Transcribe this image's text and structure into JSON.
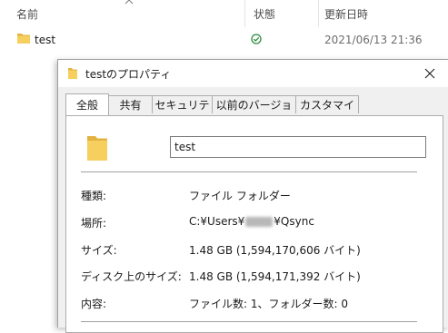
{
  "explorer": {
    "columns": {
      "name": "名前",
      "status": "状態",
      "modified": "更新日時"
    },
    "row": {
      "name": "test",
      "date": "2021/06/13 21:36"
    }
  },
  "dialog": {
    "title": "testのプロパティ",
    "tabs": [
      {
        "label": "全般"
      },
      {
        "label": "共有"
      },
      {
        "label": "セキュリティ"
      },
      {
        "label": "以前のバージョン"
      },
      {
        "label": "カスタマイズ"
      }
    ],
    "name_value": "test",
    "props": {
      "type_label": "種類:",
      "type_value": "ファイル フォルダー",
      "location_label": "場所:",
      "location_prefix": "C:¥Users¥",
      "location_suffix": "¥Qsync",
      "size_label": "サイズ:",
      "size_value": "1.48 GB (1,594,170,606 バイト)",
      "disk_size_label": "ディスク上のサイズ:",
      "disk_size_value": "1.48 GB (1,594,171,392 バイト)",
      "contents_label": "内容:",
      "contents_value": "ファイル数: 1、フォルダー数: 0"
    }
  },
  "colors": {
    "folder": "#f6cf5f",
    "folder_dark": "#e3b341",
    "ok_green": "#2e8b3d"
  },
  "icons": {
    "folder": "folder-icon",
    "status": "sync-ok-icon",
    "close": "close-icon",
    "sort": "sort-up-icon"
  }
}
